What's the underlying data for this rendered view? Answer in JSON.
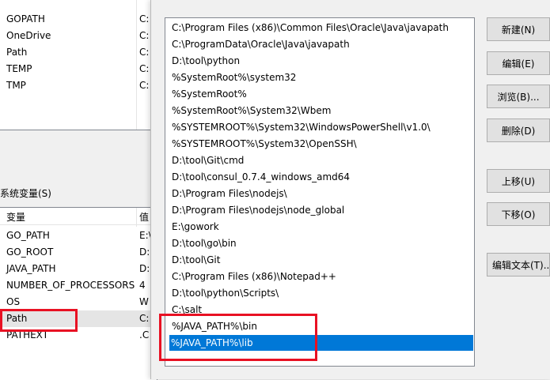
{
  "user_vars": {
    "rows": [
      {
        "name": "GOPATH",
        "value": "C:"
      },
      {
        "name": "OneDrive",
        "value": "C:"
      },
      {
        "name": "Path",
        "value": "C:"
      },
      {
        "name": "TEMP",
        "value": "C:"
      },
      {
        "name": "TMP",
        "value": "C:"
      }
    ]
  },
  "system_vars": {
    "label": "系统变量(S)",
    "header": {
      "name": "变量",
      "value": "值"
    },
    "rows": [
      {
        "name": "GO_PATH",
        "value": "E:\\"
      },
      {
        "name": "GO_ROOT",
        "value": "D:"
      },
      {
        "name": "JAVA_PATH",
        "value": "D:"
      },
      {
        "name": "NUMBER_OF_PROCESSORS",
        "value": "4"
      },
      {
        "name": "OS",
        "value": "W"
      },
      {
        "name": "Path",
        "value": "C:"
      },
      {
        "name": "PATHEXT",
        "value": ".C"
      }
    ]
  },
  "edit_dialog": {
    "path_entries": [
      "C:\\Program Files (x86)\\Common Files\\Oracle\\Java\\javapath",
      "C:\\ProgramData\\Oracle\\Java\\javapath",
      "D:\\tool\\python",
      "%SystemRoot%\\system32",
      "%SystemRoot%",
      "%SystemRoot%\\System32\\Wbem",
      "%SYSTEMROOT%\\System32\\WindowsPowerShell\\v1.0\\",
      "%SYSTEMROOT%\\System32\\OpenSSH\\",
      "D:\\tool\\Git\\cmd",
      "D:\\tool\\consul_0.7.4_windows_amd64",
      "D:\\Program Files\\nodejs\\",
      "D:\\Program Files\\nodejs\\node_global",
      "E:\\gowork",
      "D:\\tool\\go\\bin",
      "D:\\tool\\Git",
      "C:\\Program Files (x86)\\Notepad++",
      "D:\\tool\\python\\Scripts\\",
      "C:\\salt",
      "%JAVA_PATH%\\bin",
      "%JAVA_PATH%\\lib"
    ],
    "buttons": {
      "new": "新建(N)",
      "edit": "编辑(E)",
      "browse": "浏览(B)...",
      "delete": "删除(D)",
      "move_up": "上移(U)",
      "move_down": "下移(O)",
      "edit_text": "编辑文本(T)..."
    }
  },
  "colors": {
    "selection": "#0078d7",
    "highlight": "#e81123"
  }
}
